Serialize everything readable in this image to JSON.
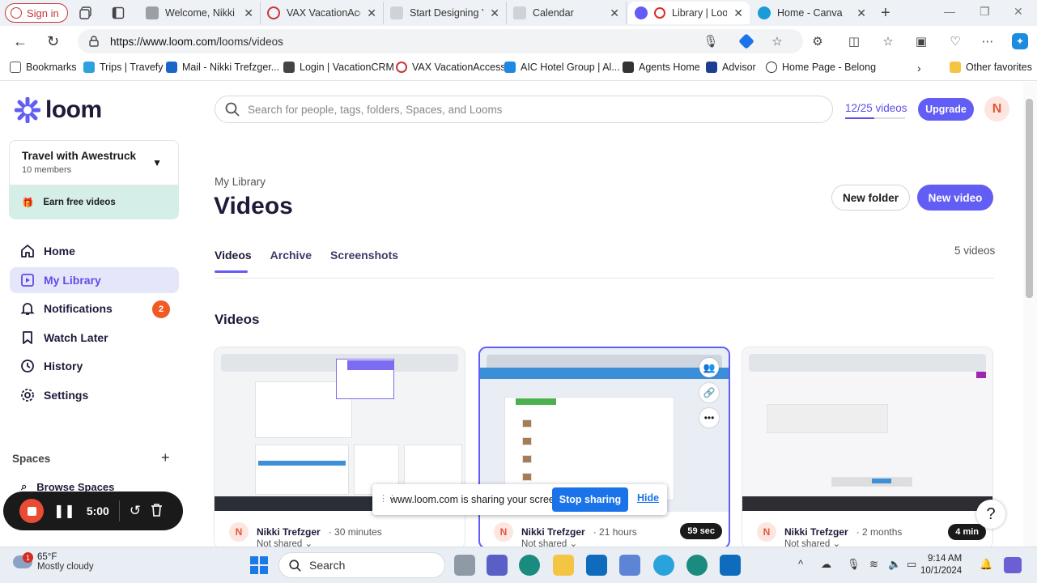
{
  "browser": {
    "signin_label": "Sign in",
    "tabs": [
      {
        "title": "Welcome, Nikki Tre",
        "color": "#9aa0a6"
      },
      {
        "title": "VAX VacationAcce",
        "color": "#c8363a"
      },
      {
        "title": "Start Designing Yo",
        "color": "#9aa0a6"
      },
      {
        "title": "Calendar",
        "color": "#9aa0a6"
      },
      {
        "title": "Library | Loom",
        "color": "#625df5"
      },
      {
        "title": "Home - Canva",
        "color": "#1b9bd8"
      }
    ],
    "url_host": "https://www.loom.com",
    "url_path": "/looms/videos",
    "bookmarks": [
      {
        "label": "Bookmarks",
        "color": "#555555"
      },
      {
        "label": "Trips | Travefy",
        "color": "#2aa3dd"
      },
      {
        "label": "Mail - Nikki Trefzger...",
        "color": "#1a66c6"
      },
      {
        "label": "Login | VacationCRM",
        "color": "#444444"
      },
      {
        "label": "VAX VacationAccess",
        "color": "#c8363a"
      },
      {
        "label": "AIC Hotel Group | Al...",
        "color": "#1e88e5"
      },
      {
        "label": "Agents Home",
        "color": "#333333"
      },
      {
        "label": "Advisor",
        "color": "#1c3f94"
      },
      {
        "label": "Home Page - Belong",
        "color": "#333333"
      }
    ],
    "other_favorites": "Other favorites"
  },
  "sidebar": {
    "logo": "loom",
    "workspace_name": "Travel with Awestruck",
    "workspace_members": "10 members",
    "earn_label": "Earn free videos",
    "nav": [
      {
        "label": "Home",
        "icon": "home-icon"
      },
      {
        "label": "My Library",
        "icon": "library-icon"
      },
      {
        "label": "Notifications",
        "icon": "bell-icon",
        "badge": "2"
      },
      {
        "label": "Watch Later",
        "icon": "bookmark-icon"
      },
      {
        "label": "History",
        "icon": "clock-icon"
      },
      {
        "label": "Settings",
        "icon": "gear-icon"
      }
    ],
    "spaces_heading": "Spaces",
    "browse_spaces": "Browse Spaces"
  },
  "main": {
    "search_placeholder": "Search for people, tags, folders, Spaces, and Looms",
    "video_count": "12/25 videos",
    "video_usage_fraction": 0.48,
    "upgrade_label": "Upgrade",
    "avatar_initial": "N",
    "breadcrumb": "My Library",
    "page_title": "Videos",
    "new_folder": "New folder",
    "new_video": "New video",
    "tabs": [
      "Videos",
      "Archive",
      "Screenshots"
    ],
    "count_label": "5 videos",
    "section_title": "Videos",
    "cards": [
      {
        "author": "Nikki Trefzger",
        "ago": "30 minutes",
        "shared": "Not shared",
        "duration": ""
      },
      {
        "author": "Nikki Trefzger",
        "ago": "21 hours",
        "shared": "Not shared",
        "duration": "59 sec"
      },
      {
        "author": "Nikki Trefzger",
        "ago": "2 months",
        "shared": "Not shared",
        "duration": "4 min"
      }
    ]
  },
  "sharing": {
    "message": "www.loom.com is sharing your screen.",
    "stop_label": "Stop sharing",
    "hide_label": "Hide"
  },
  "recorder": {
    "time": "5:00"
  },
  "taskbar": {
    "temp": "65°F",
    "weather": "Mostly cloudy",
    "weather_badge": "1",
    "search_label": "Search",
    "time": "9:14 AM",
    "date": "10/1/2024"
  },
  "colors": {
    "accent": "#625df5",
    "badge": "#f15a24",
    "earn_bg": "#d5efe8"
  }
}
